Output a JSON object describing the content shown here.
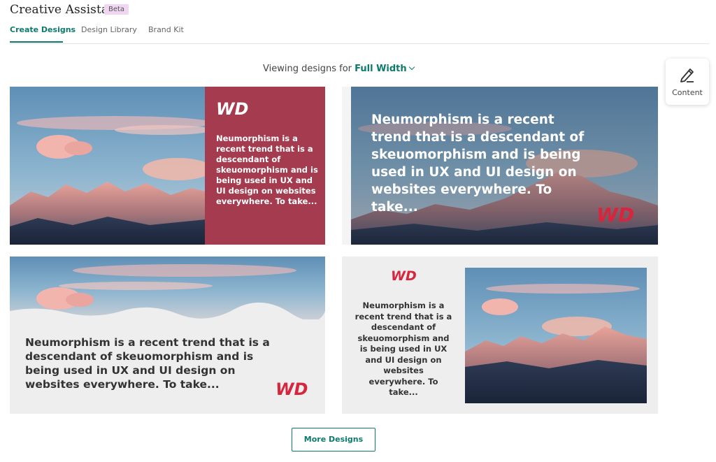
{
  "app": {
    "title": "Creative Assistant",
    "badge": "Beta"
  },
  "tabs": [
    {
      "label": "Create Designs",
      "active": true
    },
    {
      "label": "Design Library",
      "active": false
    },
    {
      "label": "Brand Kit",
      "active": false
    }
  ],
  "viewing": {
    "prefix": "Viewing designs for",
    "selected": "Full Width"
  },
  "side_panel": {
    "content_label": "Content",
    "content_icon": "pen-edit-icon"
  },
  "designs": {
    "logo_text": "WD",
    "blurb": "Neumorphism is a recent trend that is a descendant of skeuomorphism and is being used in UX and UI design on websites everywhere. To take...",
    "cards": [
      {
        "layout": "photo-left-color-panel-right",
        "panel_color": "#a53b4e"
      },
      {
        "layout": "full-bleed-photo-text-overlay"
      },
      {
        "layout": "photo-top-text-bottom"
      },
      {
        "layout": "text-left-photo-right"
      }
    ]
  },
  "more_button": "More Designs",
  "colors": {
    "accent": "#0d7a6c",
    "brand_red": "#d8253e",
    "beta_bg": "#f1d6f2"
  }
}
